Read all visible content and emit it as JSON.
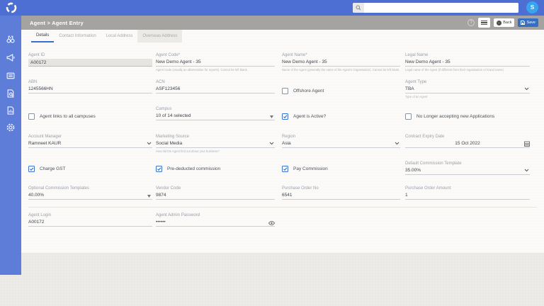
{
  "colors": {
    "accent": "#3a72cf",
    "topbar": "#4d6ed2",
    "sidebar": "#5e7dd9",
    "header_bar": "#a4a3a1",
    "avatar_bg": "#38a3ef",
    "save_button": "#346fc4"
  },
  "icons": {
    "topbar": [
      "app-logo",
      "search"
    ],
    "sidebar": [
      "binoculars",
      "megaphone",
      "book",
      "document-search",
      "document-report",
      "settings"
    ],
    "header": [
      "help",
      "hamburger-menu",
      "back-arrow",
      "save-floppy"
    ],
    "fields": [
      "chevron-down",
      "dropdown-triangle",
      "calendar",
      "eye"
    ]
  },
  "topbar": {
    "search_placeholder": "",
    "avatar_initial": "S"
  },
  "header": {
    "title": "Agent > Agent Entry",
    "back_label": "Back",
    "save_label": "Save"
  },
  "tabs": [
    "Details",
    "Contact Information",
    "Local Address",
    "Overseas Address"
  ],
  "fields": {
    "agent_id": {
      "label": "Agent ID",
      "value": "A00172"
    },
    "agent_code": {
      "label": "Agent Code*",
      "value": "New Demo Agent - 35",
      "helper": "Agent Code (usually an abbreviation for reports). Cannot be left blank."
    },
    "agent_name": {
      "label": "Agent Name*",
      "value": "New Demo Agent - 35",
      "helper": "Name of the Agent (generally the name of the Agent's Organisation). Cannot be left blank."
    },
    "legal_name": {
      "label": "Legal Name",
      "value": "New Demo Agent - 35",
      "helper": "Legal name of the Agent (if different from their organisation or brand name)"
    },
    "abn": {
      "label": "ABN",
      "value": "1245566HN"
    },
    "acn": {
      "label": "ACN",
      "value": "ASF123456"
    },
    "offshore_agent": {
      "label": "Offshore Agent",
      "checked": false
    },
    "agent_type": {
      "label": "Agent Type",
      "value": "TBA",
      "helper": "Type of an Agent"
    },
    "links_all_campuses": {
      "label": "Agent links to all campuses",
      "checked": false
    },
    "campus": {
      "label": "Campus",
      "value": "10 of 14 selected"
    },
    "agent_active": {
      "label": "Agent is Active?",
      "checked": true
    },
    "no_new_apps": {
      "label": "No Longer accepting new Applications",
      "checked": false
    },
    "account_manager": {
      "label": "Account Manager",
      "value": "Ramneet KAUR"
    },
    "marketing_source": {
      "label": "Marketing Source",
      "value": "Social Media",
      "helper": "How did the Agent find out about your business?"
    },
    "region": {
      "label": "Region",
      "value": "Asia"
    },
    "contract_expiry": {
      "label": "Contract Expiry Date",
      "value": "15 Oct 2022"
    },
    "charge_gst": {
      "label": "Charge GST",
      "checked": true
    },
    "pre_deducted": {
      "label": "Pre-deducted commission",
      "checked": true
    },
    "pay_commission": {
      "label": "Pay Commission",
      "checked": true
    },
    "default_commission_template": {
      "label": "Default Commission Template",
      "value": "35.00%"
    },
    "optional_commission_templates": {
      "label": "Optional Commission Templates",
      "value": "40.00%"
    },
    "vendor_code": {
      "label": "Vendor Code",
      "value": "9874"
    },
    "purchase_order_no": {
      "label": "Purchase Order No",
      "value": "6541"
    },
    "purchase_order_amount": {
      "label": "Purchase Order Amount",
      "value": "1"
    },
    "agent_login": {
      "label": "Agent Login",
      "value": "A00172"
    },
    "agent_admin_password": {
      "label": "Agent Admin Password",
      "value": "••••••"
    }
  }
}
